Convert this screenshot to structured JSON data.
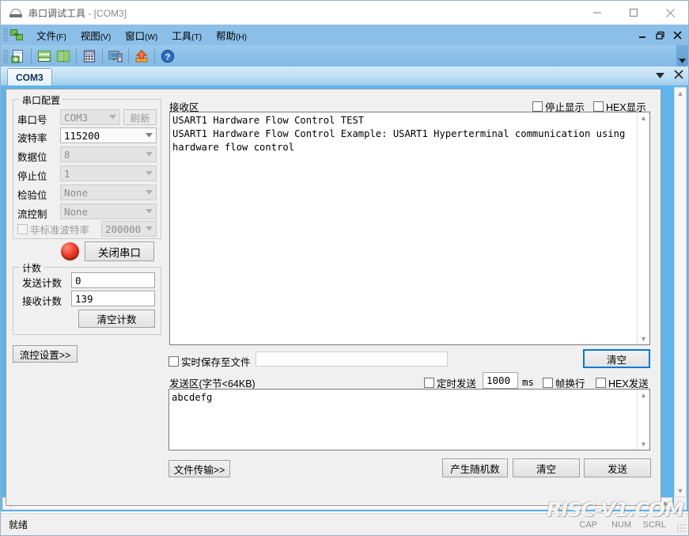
{
  "window": {
    "title": "串口调试工具",
    "document": "- [COM3]",
    "icon": "serial-tool-icon",
    "minimize": "−",
    "maximize": "□",
    "close": "✕"
  },
  "menubar": {
    "items": [
      {
        "label": "文件",
        "accel": "(F)"
      },
      {
        "label": "视图",
        "accel": "(V)"
      },
      {
        "label": "窗口",
        "accel": "(W)"
      },
      {
        "label": "工具",
        "accel": "(T)"
      },
      {
        "label": "帮助",
        "accel": "(H)"
      }
    ],
    "mdi_minimize": "minimize-icon",
    "mdi_restore": "restore-icon",
    "mdi_close": "close-icon"
  },
  "toolbar": {
    "buttons": [
      "new-document-icon",
      "tile-horizontal-icon",
      "tile-vertical-icon",
      "calculator-icon",
      "monitor-icon",
      "upload-icon",
      "help-icon"
    ],
    "overflow": "toolbar-overflow-icon"
  },
  "tabs": {
    "items": [
      {
        "label": "COM3",
        "active": true
      }
    ],
    "dropdown": "tab-list-dropdown-icon",
    "close": "tab-close-icon"
  },
  "serial_config": {
    "group_title": "串口配置",
    "fields": [
      {
        "label": "串口号",
        "value": "COM3",
        "disabled": true,
        "name": "port"
      },
      {
        "label": "波特率",
        "value": "115200",
        "disabled": false,
        "name": "baudrate"
      },
      {
        "label": "数据位",
        "value": "8",
        "disabled": true,
        "name": "databits"
      },
      {
        "label": "停止位",
        "value": "1",
        "disabled": true,
        "name": "stopbits"
      },
      {
        "label": "检验位",
        "value": "None",
        "disabled": true,
        "name": "parity"
      },
      {
        "label": "流控制",
        "value": "None",
        "disabled": true,
        "name": "flowcontrol"
      }
    ],
    "refresh_button": "刷新",
    "custom_baud": {
      "label": "非标准波特率",
      "value": "200000",
      "checked": false
    },
    "open_close_button": "关闭串口",
    "led": "status-led-red"
  },
  "counters": {
    "group_title": "计数",
    "tx_label": "发送计数",
    "tx_value": "0",
    "rx_label": "接收计数",
    "rx_value": "139",
    "clear_button": "清空计数"
  },
  "flow_control": {
    "button": "流控设置>>"
  },
  "receive": {
    "title": "接收区",
    "stop_display": {
      "label": "停止显示",
      "checked": false
    },
    "hex_display": {
      "label": "HEX显示",
      "checked": false
    },
    "content": "USART1 Hardware Flow Control TEST\nUSART1 Hardware Flow Control Example: USART1 Hyperterminal communication using\nhardware flow control",
    "save_to_file": {
      "label": "实时保存至文件",
      "checked": false,
      "path": ""
    },
    "clear_button": "清空"
  },
  "send": {
    "title": "发送区(字节<64KB)",
    "timed_send": {
      "label": "定时发送",
      "checked": false
    },
    "interval_value": "1000",
    "interval_unit": "ms",
    "frame_newline": {
      "label": "帧换行",
      "checked": false
    },
    "hex_send": {
      "label": "HEX发送",
      "checked": false
    },
    "content": "abcdefg",
    "file_transfer_button": "文件传输>>",
    "random_button": "产生随机数",
    "clear_button": "清空",
    "send_button": "发送"
  },
  "statusbar": {
    "text": "就绪",
    "cap": "CAP",
    "num": "NUM",
    "scrl": "SCRL"
  },
  "watermark": "RISC-V1.COM",
  "colors": {
    "chrome_blue": "#8cbfe8",
    "mdi_blue": "#5eb4ec",
    "panel_gray": "#f0f0f0",
    "focus_blue": "#0078d7",
    "led_red": "#f03c26"
  }
}
